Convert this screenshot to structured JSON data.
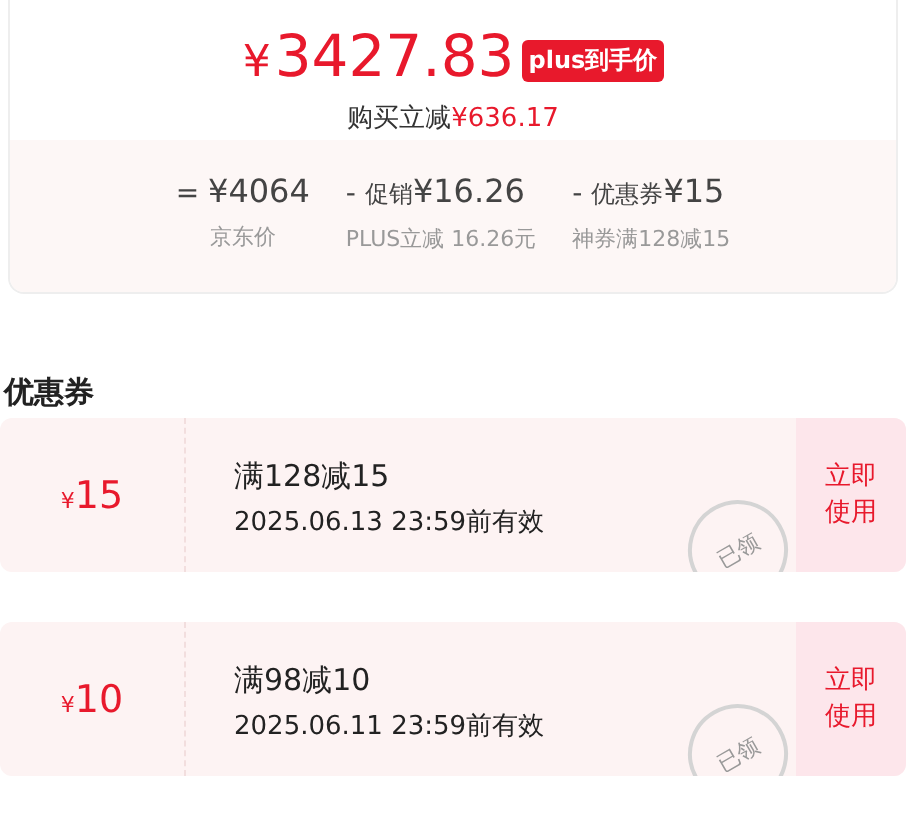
{
  "price": {
    "currency": "¥",
    "amount": "3427.83",
    "badge": "plus到手价",
    "saving_label": "购买立减",
    "saving": "¥636.17"
  },
  "breakdown": [
    {
      "op": "=",
      "value": "¥4064",
      "note": "京东价"
    },
    {
      "op": "-",
      "label": "促销",
      "value": "¥16.26",
      "note": "PLUS立减 16.26元"
    },
    {
      "op": "-",
      "label": "优惠券",
      "value": "¥15",
      "note": "神券满128减15"
    }
  ],
  "coupon_section": {
    "title": "优惠券"
  },
  "coupons": [
    {
      "currency": "¥",
      "amount": "15",
      "condition": "满128减15",
      "expiry": "2025.06.13 23:59前有效",
      "stamp": "已领",
      "action": "立即使用"
    },
    {
      "currency": "¥",
      "amount": "10",
      "condition": "满98减10",
      "expiry": "2025.06.11 23:59前有效",
      "stamp": "已领",
      "action": "立即使用"
    }
  ]
}
